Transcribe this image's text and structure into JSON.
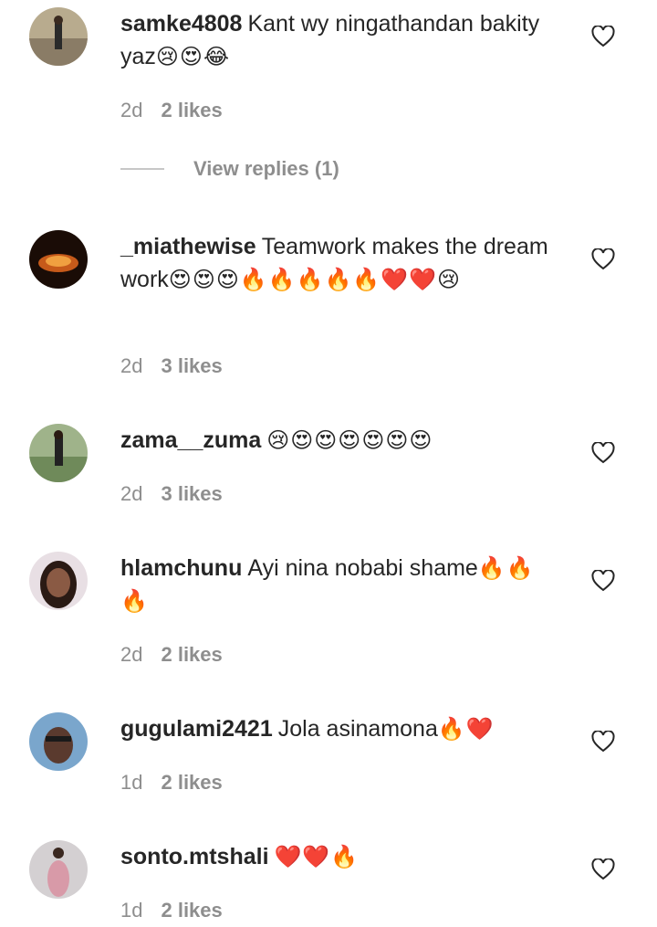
{
  "comments": [
    {
      "username": "samke4808",
      "text": "Kant wy ningathandan bakity yaz",
      "emoji": "😢😍😂",
      "age": "2d",
      "likes": "2 likes",
      "avatar_color": "#8a7c66"
    },
    {
      "username": "_miathewise",
      "text": "Teamwork makes the dream work",
      "emoji": "😍😍😍🔥🔥🔥🔥🔥❤️❤️😢",
      "age": "2d",
      "likes": "3 likes",
      "avatar_color": "#3a2010"
    },
    {
      "username": "zama__zuma",
      "text": "",
      "emoji": "😢😍😍😍😍😍😍",
      "age": "2d",
      "likes": "3 likes",
      "avatar_color": "#6f8a5a"
    },
    {
      "username": "hlamchunu",
      "text": "Ayi nina nobabi shame",
      "emoji": "🔥🔥🔥",
      "age": "2d",
      "likes": "2 likes",
      "avatar_color": "#4a3028"
    },
    {
      "username": "gugulami2421",
      "text": "Jola asinamona",
      "emoji": "🔥❤️",
      "age": "1d",
      "likes": "2 likes",
      "avatar_color": "#5a86b0"
    },
    {
      "username": "sonto.mtshali",
      "text": "",
      "emoji": "❤️❤️🔥",
      "age": "1d",
      "likes": "2 likes",
      "avatar_color": "#b9b4b8"
    }
  ],
  "view_replies_label": "View replies (1)",
  "colors": {
    "text": "#262626",
    "muted": "#8e8e8e",
    "divider": "#c7c7c7"
  }
}
